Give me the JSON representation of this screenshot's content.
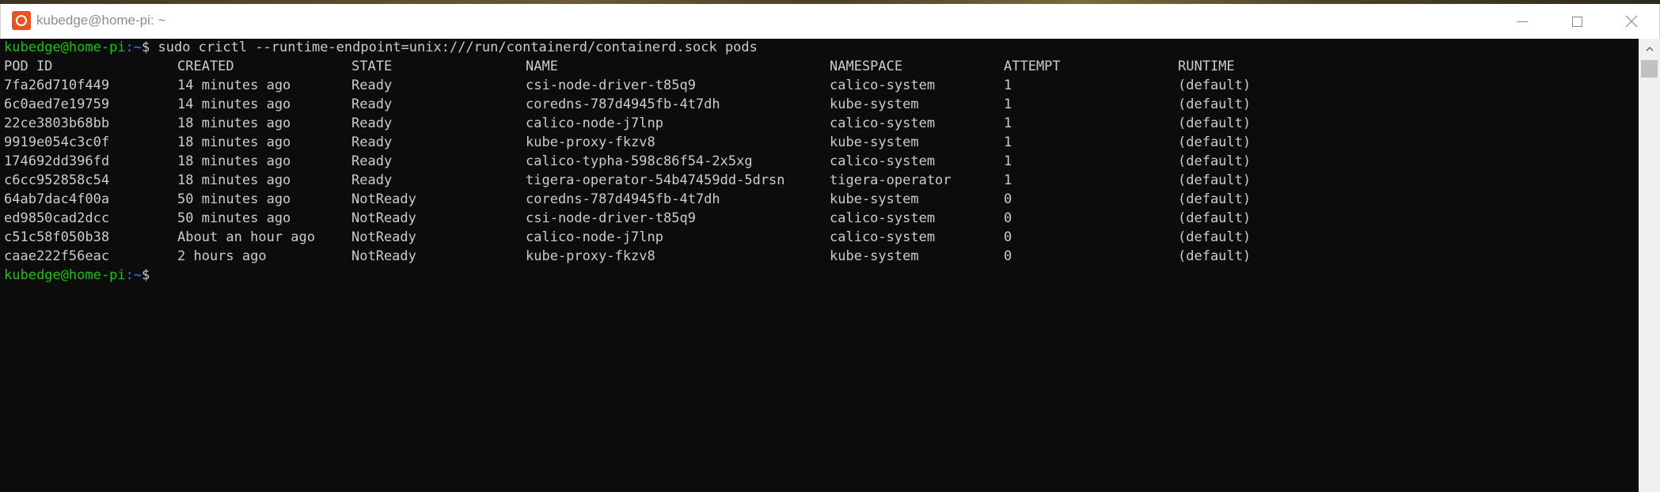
{
  "window": {
    "title": "kubedge@home-pi: ~"
  },
  "colors": {
    "prompt_user": "#16c60c",
    "prompt_path": "#3b78ff",
    "terminal_bg": "#0c0c0c",
    "terminal_fg": "#cccccc",
    "app_icon": "#e95420"
  },
  "icons": {
    "app": "ubuntu-terminal-icon",
    "minimize": "minimize-icon",
    "maximize": "maximize-icon",
    "close": "close-icon",
    "scroll_up": "chevron-up-icon"
  },
  "terminal": {
    "command_prompt": {
      "user_host": "kubedge@home-pi",
      "path": ":~",
      "symbol": "$",
      "command": " sudo crictl --runtime-endpoint=unix:///run/containerd/containerd.sock pods"
    },
    "headers": [
      "POD ID",
      "CREATED",
      "STATE",
      "NAME",
      "NAMESPACE",
      "ATTEMPT",
      "RUNTIME"
    ],
    "rows": [
      [
        "7fa26d710f449",
        "14 minutes ago",
        "Ready",
        "csi-node-driver-t85q9",
        "calico-system",
        "1",
        "(default)"
      ],
      [
        "6c0aed7e19759",
        "14 minutes ago",
        "Ready",
        "coredns-787d4945fb-4t7dh",
        "kube-system",
        "1",
        "(default)"
      ],
      [
        "22ce3803b68bb",
        "18 minutes ago",
        "Ready",
        "calico-node-j7lnp",
        "calico-system",
        "1",
        "(default)"
      ],
      [
        "9919e054c3c0f",
        "18 minutes ago",
        "Ready",
        "kube-proxy-fkzv8",
        "kube-system",
        "1",
        "(default)"
      ],
      [
        "174692dd396fd",
        "18 minutes ago",
        "Ready",
        "calico-typha-598c86f54-2x5xg",
        "calico-system",
        "1",
        "(default)"
      ],
      [
        "c6cc952858c54",
        "18 minutes ago",
        "Ready",
        "tigera-operator-54b47459dd-5drsn",
        "tigera-operator",
        "1",
        "(default)"
      ],
      [
        "64ab7dac4f00a",
        "50 minutes ago",
        "NotReady",
        "coredns-787d4945fb-4t7dh",
        "kube-system",
        "0",
        "(default)"
      ],
      [
        "ed9850cad2dcc",
        "50 minutes ago",
        "NotReady",
        "csi-node-driver-t85q9",
        "calico-system",
        "0",
        "(default)"
      ],
      [
        "c51c58f050b38",
        "About an hour ago",
        "NotReady",
        "calico-node-j7lnp",
        "calico-system",
        "0",
        "(default)"
      ],
      [
        "caae222f56eac",
        "2 hours ago",
        "NotReady",
        "kube-proxy-fkzv8",
        "kube-system",
        "0",
        "(default)"
      ]
    ],
    "end_prompt": {
      "user_host": "kubedge@home-pi",
      "path": ":~",
      "symbol": "$"
    }
  }
}
